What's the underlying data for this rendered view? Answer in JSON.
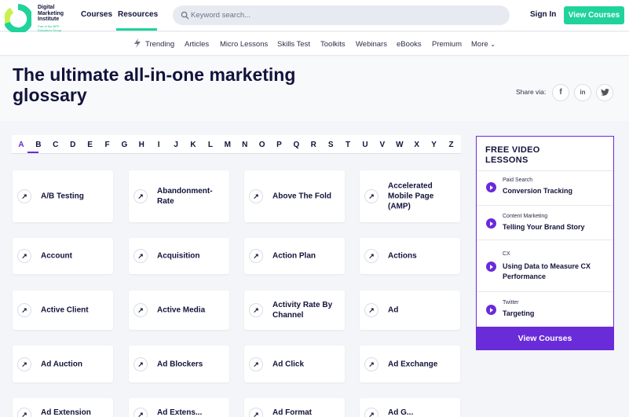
{
  "header": {
    "logo_text": "Digital Marketing Institute",
    "logo_subtext": "Part of the BPP Education Group",
    "nav": [
      "Courses",
      "Resources"
    ],
    "search_placeholder": "Keyword search...",
    "signin": "Sign In",
    "cta": "View Courses"
  },
  "subnav": [
    "Trending",
    "Articles",
    "Micro Lessons",
    "Skills Test",
    "Toolkits",
    "Webinars",
    "eBooks",
    "Premium",
    "More"
  ],
  "hero": {
    "title": "The ultimate all-in-one marketing glossary",
    "share_label": "Share via:",
    "share": [
      "f",
      "in",
      "t"
    ]
  },
  "alphabet": [
    "A",
    "B",
    "C",
    "D",
    "E",
    "F",
    "G",
    "H",
    "I",
    "J",
    "K",
    "L",
    "M",
    "N",
    "O",
    "P",
    "Q",
    "R",
    "S",
    "T",
    "U",
    "V",
    "W",
    "X",
    "Y",
    "Z"
  ],
  "active_letter": "A",
  "terms": [
    "A/B Testing",
    "Abandonment-Rate",
    "Above The Fold",
    "Accelerated Mobile Page (AMP)",
    "Account",
    "Acquisition",
    "Action Plan",
    "Actions",
    "Active Client",
    "Active Media",
    "Activity Rate By Channel",
    "Ad",
    "Ad Auction",
    "Ad Blockers",
    "Ad Click",
    "Ad Exchange",
    "Ad Extension",
    "Ad Extens...",
    "Ad Format",
    "Ad G..."
  ],
  "sidebar": {
    "title": "FREE VIDEO LESSONS",
    "lessons": [
      {
        "category": "Paid Search",
        "title": "Conversion Tracking"
      },
      {
        "category": "Content Marketing",
        "title": "Telling Your Brand Story"
      },
      {
        "category": "CX",
        "title": "Using Data to Measure CX Performance"
      },
      {
        "category": "Twitter",
        "title": "Targeting"
      }
    ],
    "button": "View Courses"
  },
  "colors": {
    "accent": "#6a2bd9",
    "brand": "#1fd39b",
    "text": "#12133b"
  }
}
